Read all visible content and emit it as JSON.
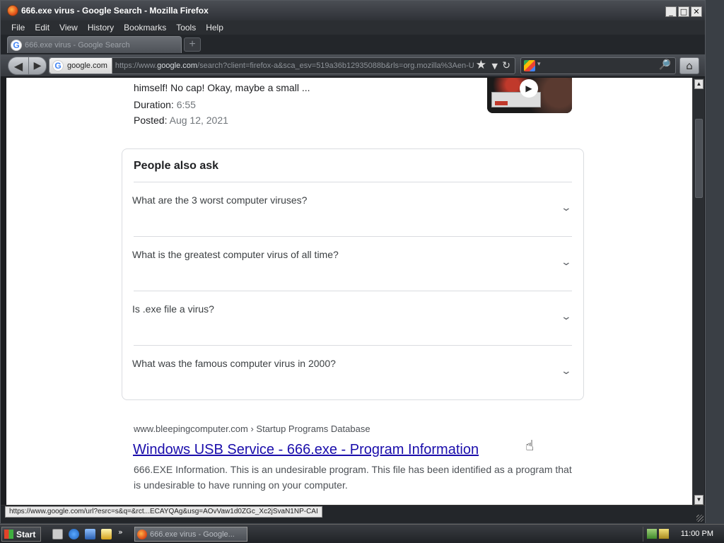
{
  "window": {
    "title": "666.exe virus - Google Search - Mozilla Firefox",
    "controls": {
      "minimize": "_",
      "maximize": "□",
      "close": "✕"
    }
  },
  "menubar": {
    "items": [
      "File",
      "Edit",
      "View",
      "History",
      "Bookmarks",
      "Tools",
      "Help"
    ]
  },
  "tabs": [
    {
      "label": "666.exe virus - Google Search",
      "active": true
    }
  ],
  "newtab_label": "+",
  "navbar": {
    "back_icon": "◀",
    "forward_icon": "▶",
    "site_identity": "google.com",
    "url_prefix": "https://www.",
    "url_host": "google.com",
    "url_rest": "/search?client=firefox-a&sca_esv=519a36b12935088b&rls=org.mozilla%3Aen-U",
    "star_icon": "★",
    "dropdown_icon": "▼",
    "reload_icon": "↻",
    "search_placeholder": "",
    "search_engine_arrow": "▾",
    "magnifier_icon": "🔎",
    "home_icon": "⌂"
  },
  "video_result": {
    "snippet_tail": "himself! No cap! Okay, maybe a small ...",
    "duration_label": "Duration:",
    "duration_value": "6:55",
    "posted_label": "Posted:",
    "posted_value": "Aug 12, 2021",
    "play_icon": "▶"
  },
  "people_also_ask": {
    "title": "People also ask",
    "chevron": "⌄",
    "questions": [
      "What are the 3 worst computer viruses?",
      "What is the greatest computer virus of all time?",
      "Is .exe file a virus?",
      "What was the famous computer virus in 2000?"
    ]
  },
  "result": {
    "cite": "www.bleepingcomputer.com › Startup Programs Database",
    "title": "Windows USB Service - 666.exe - Program Information",
    "snippet": "666.EXE Information. This is an undesirable program. This file has been identified as a program that is undesirable to have running on your computer."
  },
  "statusbar": {
    "hover_url": "https://www.google.com/url?esrc=s&q=&rct...ECAYQAg&usg=AOvVaw1d0ZGc_Xc2jSvaN1NP-CAI"
  },
  "taskbar": {
    "start_label": "Start",
    "more_arrow": "»",
    "active_task": "666.exe virus - Google...",
    "clock": "11:00 PM"
  },
  "cursor_icon": "☝"
}
